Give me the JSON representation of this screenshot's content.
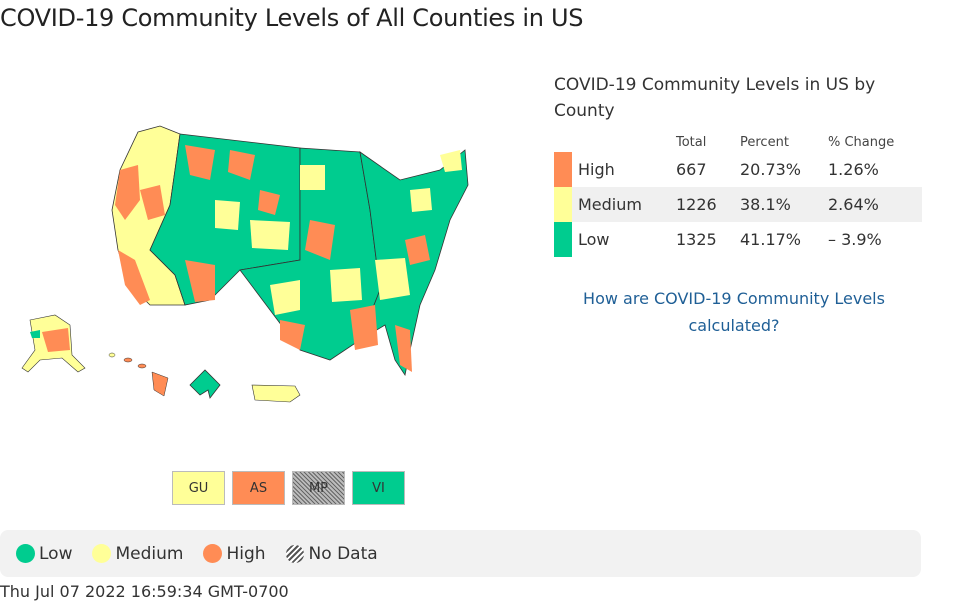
{
  "page": {
    "title": "COVID-19 Community Levels of All Counties in US",
    "timestamp": "Thu Jul 07 2022 16:59:34 GMT-0700"
  },
  "colors": {
    "low": "#00cc8f",
    "medium": "#ffff98",
    "high": "#ff8c55",
    "link": "#1f5f96"
  },
  "map": {
    "label": "US county map of COVID-19 community levels",
    "insets": [
      "Alaska",
      "Hawaii",
      "District of Columbia",
      "Puerto Rico"
    ]
  },
  "territories": [
    {
      "code": "GU",
      "level": "medium"
    },
    {
      "code": "AS",
      "level": "high"
    },
    {
      "code": "MP",
      "level": "nodata"
    },
    {
      "code": "VI",
      "level": "low"
    }
  ],
  "summary": {
    "title": "COVID-19 Community Levels in US by County",
    "headers": {
      "total": "Total",
      "percent": "Percent",
      "change": "% Change"
    },
    "rows": [
      {
        "level": "High",
        "total": "667",
        "percent": "20.73%",
        "change": "1.26%"
      },
      {
        "level": "Medium",
        "total": "1226",
        "percent": "38.1%",
        "change": "2.64%"
      },
      {
        "level": "Low",
        "total": "1325",
        "percent": "41.17%",
        "change": "– 3.9%"
      }
    ],
    "link_text": "How are COVID-19 Community Levels calculated?"
  },
  "legend": {
    "items": [
      {
        "label": "Low",
        "icon": "circle-low"
      },
      {
        "label": "Medium",
        "icon": "circle-medium"
      },
      {
        "label": "High",
        "icon": "circle-high"
      },
      {
        "label": "No Data",
        "icon": "hatched-circle"
      }
    ]
  }
}
